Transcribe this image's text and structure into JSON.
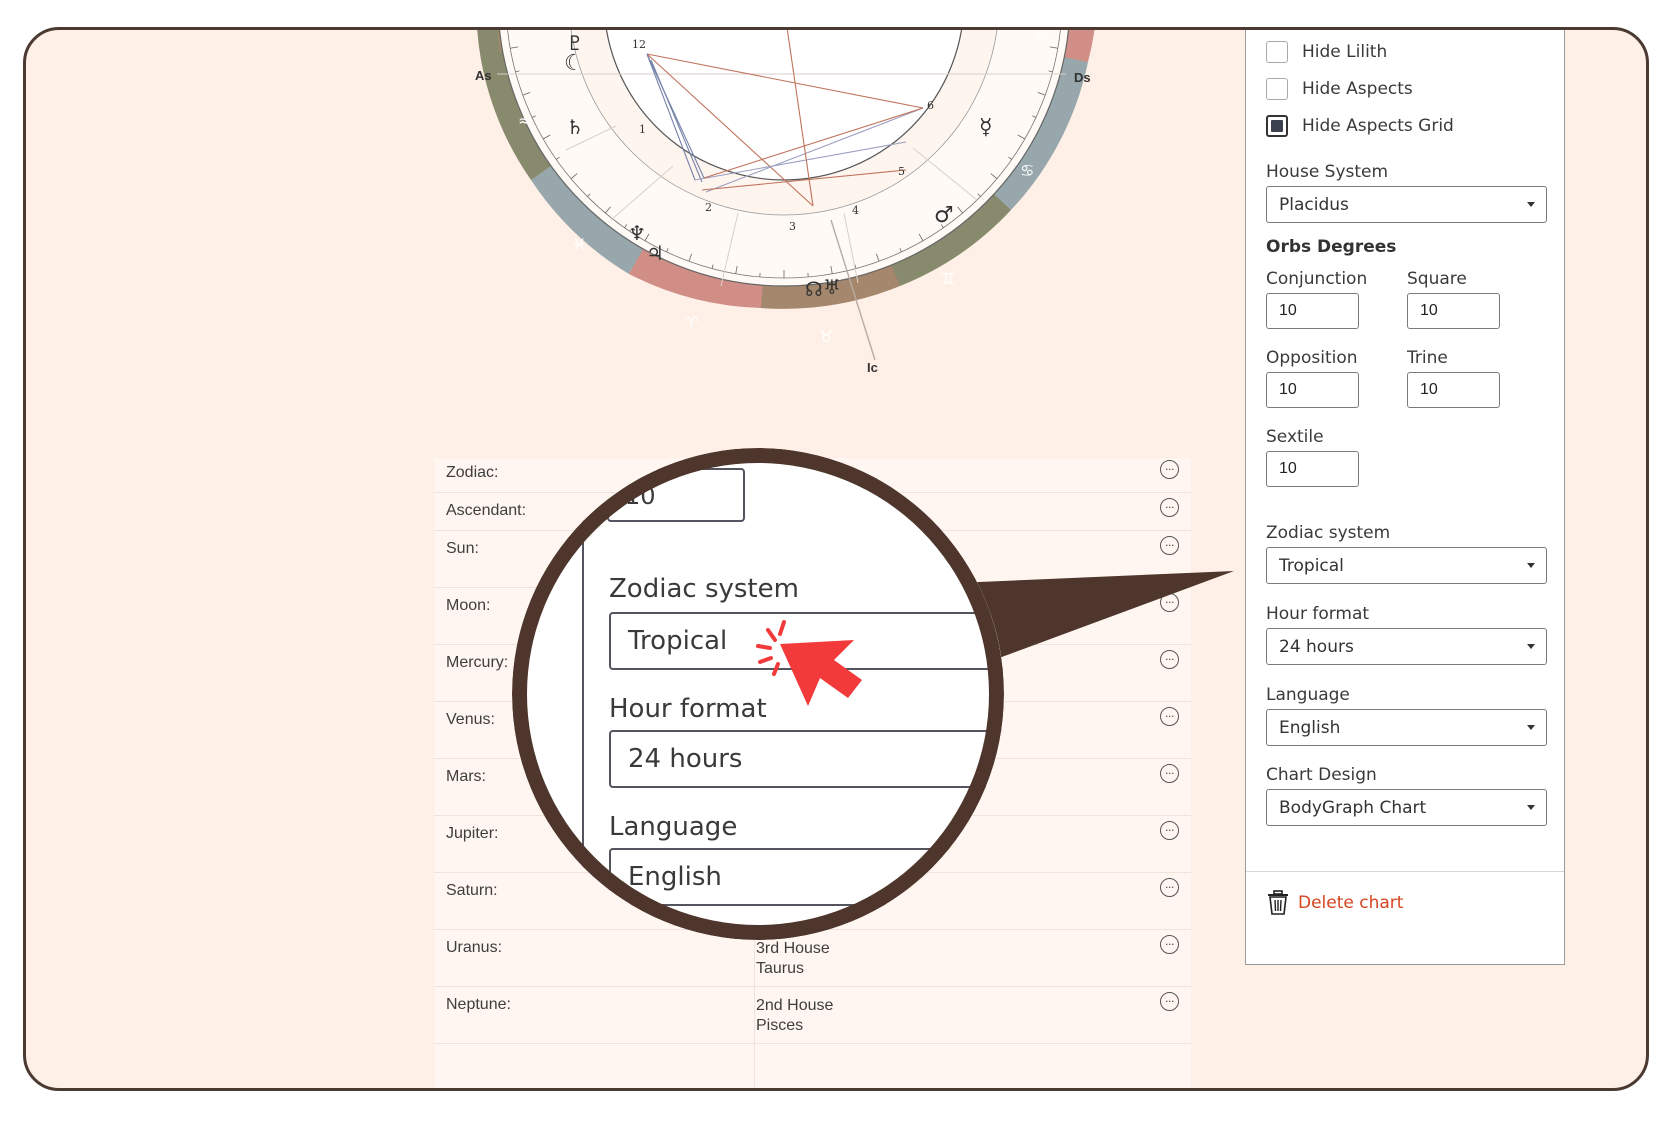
{
  "chart": {
    "axis_labels": {
      "asc": "As",
      "desc": "Ds",
      "ic": "Ic"
    },
    "house_numbers": [
      "12",
      "1",
      "2",
      "3",
      "4",
      "5",
      "6"
    ],
    "zodiac_glyphs": [
      "≈",
      "♓",
      "♈",
      "♉",
      "♊",
      "♋",
      "♌"
    ],
    "planet_glyphs": {
      "pluto": "♇",
      "moon": "☾",
      "saturn": "♄",
      "neptune": "♆",
      "jupiter": "♃",
      "node": "☊",
      "uranus": "♅",
      "mars": "♂",
      "mercury": "☿"
    }
  },
  "table": {
    "rows": [
      {
        "label": "Zodiac:",
        "value": ""
      },
      {
        "label": "Ascendant:",
        "value": ""
      },
      {
        "label": "Sun:",
        "value": ""
      },
      {
        "label": "Moon:",
        "value": ""
      },
      {
        "label": "Mercury:",
        "value": ""
      },
      {
        "label": "Venus:",
        "value": ""
      },
      {
        "label": "Mars:",
        "value": ""
      },
      {
        "label": "Jupiter:",
        "value": ""
      },
      {
        "label": "Saturn:",
        "value": ""
      },
      {
        "label": "Uranus:",
        "value": "3rd House\nTaurus",
        "line1": "3rd House",
        "line2": "Taurus"
      },
      {
        "label": "Neptune:",
        "value": "2nd House\nPisces",
        "line1": "2nd House",
        "line2": "Pisces"
      }
    ],
    "more_glyph": "···"
  },
  "zoom": {
    "partial_value": "10",
    "zodiac_label": "Zodiac system",
    "zodiac_value": "Tropical",
    "hour_label": "Hour format",
    "hour_value": "24 hours",
    "language_label": "Language",
    "language_value": "English"
  },
  "settings": {
    "checkboxes": [
      {
        "label": "Hide Lilith",
        "checked": false
      },
      {
        "label": "Hide Aspects",
        "checked": false
      },
      {
        "label": "Hide Aspects Grid",
        "checked": true
      }
    ],
    "house_system": {
      "label": "House System",
      "value": "Placidus"
    },
    "orbs_heading": "Orbs Degrees",
    "orbs": {
      "conjunction": {
        "label": "Conjunction",
        "value": "10"
      },
      "square": {
        "label": "Square",
        "value": "10"
      },
      "opposition": {
        "label": "Opposition",
        "value": "10"
      },
      "trine": {
        "label": "Trine",
        "value": "10"
      },
      "sextile": {
        "label": "Sextile",
        "value": "10"
      }
    },
    "zodiac_system": {
      "label": "Zodiac system",
      "value": "Tropical"
    },
    "hour_format": {
      "label": "Hour format",
      "value": "24 hours"
    },
    "language": {
      "label": "Language",
      "value": "English"
    },
    "chart_design": {
      "label": "Chart Design",
      "value": "BodyGraph Chart"
    },
    "delete_label": "Delete chart"
  },
  "colors": {
    "frame_bg": "#fff0e7",
    "frame_border": "#4a3a31",
    "callout": "#4e362c",
    "cursor_red": "#f23a3a",
    "delete_red": "#d5451f",
    "checkbox_fill": "#3c4150",
    "sign_olive": "#878a6c",
    "sign_blue": "#97a7ab",
    "sign_rose": "#d08e87",
    "sign_tan": "#a5876d"
  }
}
